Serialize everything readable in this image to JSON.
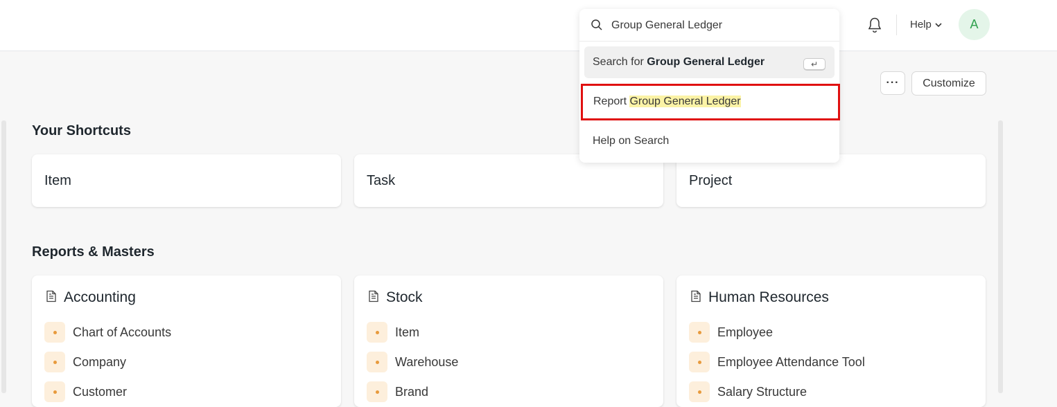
{
  "navbar": {
    "help_label": "Help",
    "avatar_initial": "A"
  },
  "search": {
    "query": "Group General Ledger",
    "search_for_prefix": "Search for",
    "search_for_term": "Group General Ledger",
    "enter_key": "↵",
    "report_prefix": "Report",
    "report_term": "Group General Ledger",
    "help_on_search": "Help on Search"
  },
  "toolbar": {
    "more_label": "···",
    "customize_label": "Customize"
  },
  "shortcuts": {
    "title": "Your Shortcuts",
    "items": [
      {
        "label": "Item"
      },
      {
        "label": "Task"
      },
      {
        "label": "Project"
      }
    ]
  },
  "reports": {
    "title": "Reports & Masters",
    "cards": [
      {
        "title": "Accounting",
        "links": [
          "Chart of Accounts",
          "Company",
          "Customer"
        ]
      },
      {
        "title": "Stock",
        "links": [
          "Item",
          "Warehouse",
          "Brand"
        ]
      },
      {
        "title": "Human Resources",
        "links": [
          "Employee",
          "Employee Attendance Tool",
          "Salary Structure"
        ]
      }
    ]
  },
  "colors": {
    "highlight": "#fbf3a6",
    "selection_border": "#e01010",
    "avatar_bg": "#e4f5e9",
    "avatar_text": "#30a14e",
    "link_dot": "#e89a3c"
  }
}
